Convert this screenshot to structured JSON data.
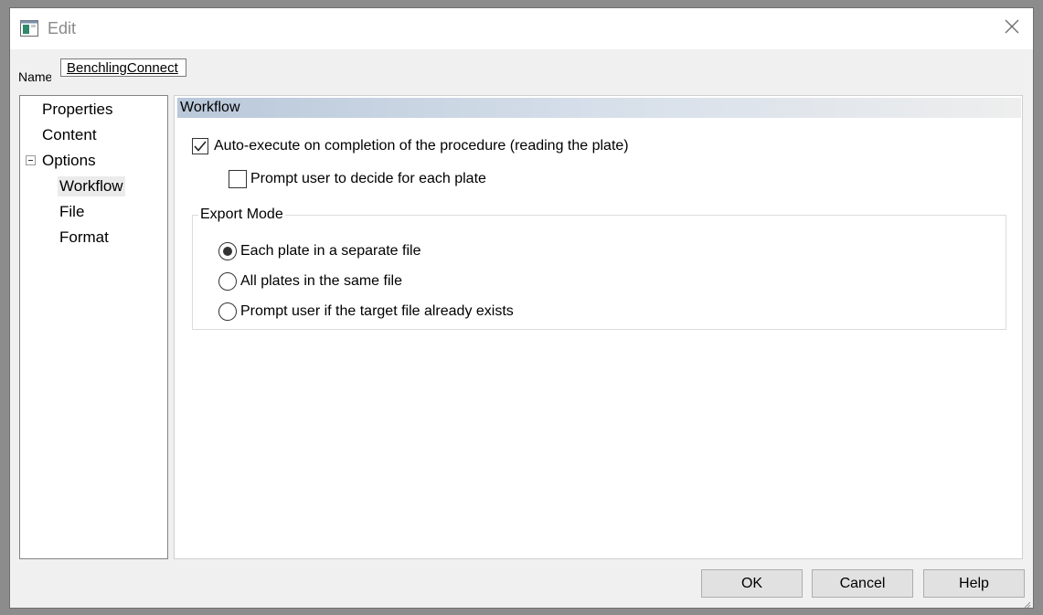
{
  "window": {
    "title": "Edit",
    "icons": {
      "app": "window-icon",
      "close": "close-icon"
    }
  },
  "name_field": {
    "label": "Name",
    "value": "BenchlingConnect"
  },
  "tree": {
    "items": [
      {
        "label": "Properties"
      },
      {
        "label": "Content"
      },
      {
        "label": "Options",
        "expanded": true,
        "icon": "collapse-minus-icon"
      },
      {
        "label": "Workflow",
        "selected": true
      },
      {
        "label": "File"
      },
      {
        "label": "Format"
      }
    ]
  },
  "panel": {
    "header": "Workflow",
    "auto_execute": {
      "label": "Auto-execute on completion of the procedure (reading the plate)",
      "checked": true
    },
    "prompt_each_plate": {
      "label": "Prompt user to decide for each plate",
      "checked": false
    },
    "export_mode": {
      "title": "Export Mode",
      "options": [
        {
          "label": "Each plate in a separate file",
          "selected": true
        },
        {
          "label": "All plates in the same file",
          "selected": false
        },
        {
          "label": "Prompt user if the target file already exists",
          "selected": false
        }
      ]
    }
  },
  "buttons": {
    "ok": "OK",
    "cancel": "Cancel",
    "help": "Help"
  },
  "colors": {
    "header_gradient_start": "#b9c8da",
    "header_gradient_end": "#eeeeee",
    "button_face": "#e1e1e1",
    "window_bg": "#f0f0f0"
  }
}
